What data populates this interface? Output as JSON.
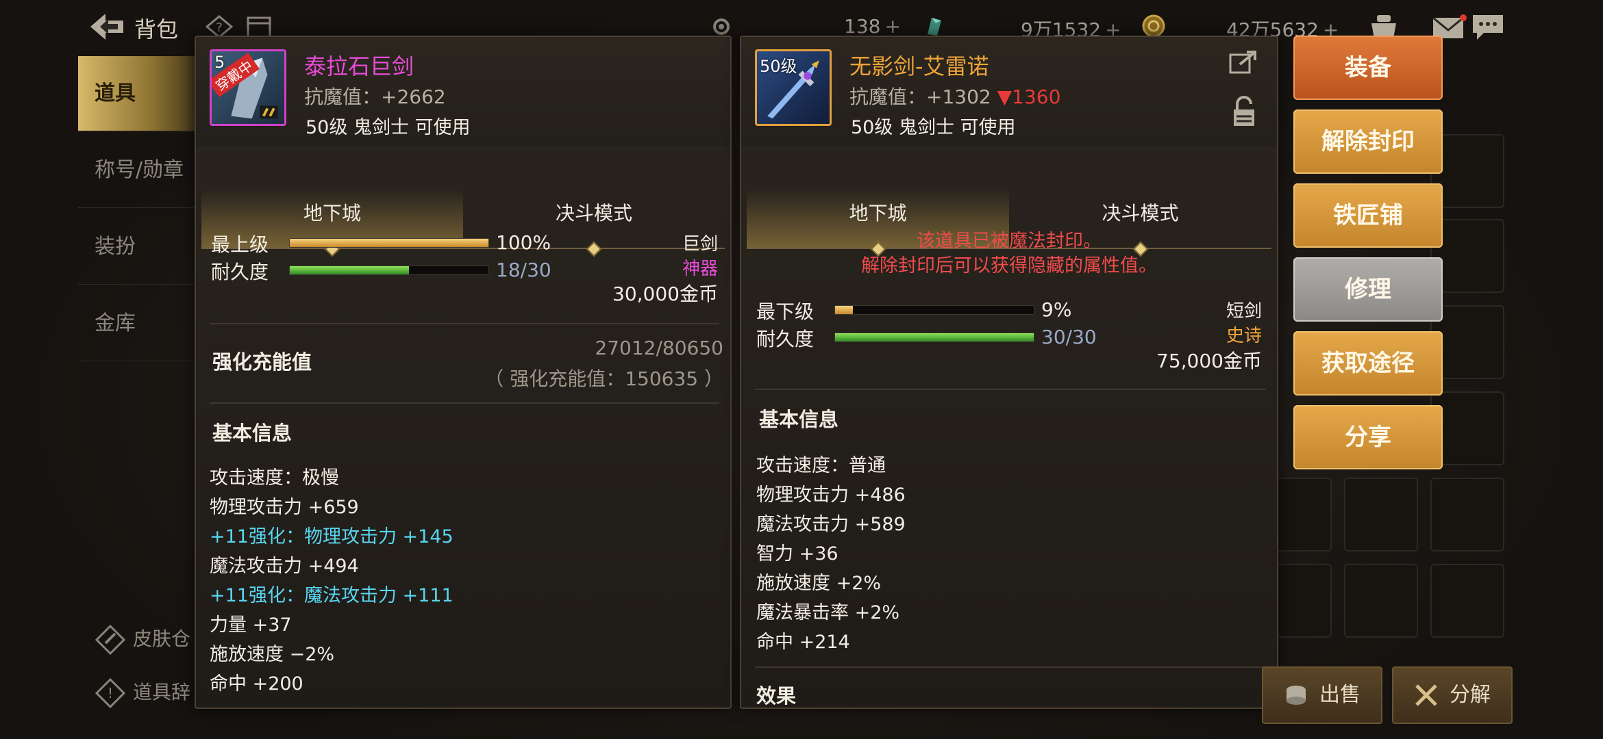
{
  "topbar": {
    "title": "背包",
    "currencies": [
      {
        "amount": "138",
        "plus": "+"
      },
      {
        "amount": "9万1532",
        "plus": "+"
      },
      {
        "amount": "42万5632",
        "plus": "+"
      }
    ]
  },
  "sidebar": {
    "items": [
      {
        "label": "道具",
        "active": true
      },
      {
        "label": "称号/勋章",
        "active": false
      },
      {
        "label": "装扮",
        "active": false
      },
      {
        "label": "金库",
        "active": false
      }
    ],
    "bottom_links": [
      "皮肤仓",
      "道具辞"
    ]
  },
  "left_item": {
    "thumb_level": "5",
    "thumb_tag": "穿戴中",
    "name": "泰拉石巨剑",
    "magic_resist": "抗魔值：+2662",
    "requirement": "50级 鬼剑士 可使用",
    "tabs": [
      "地下城",
      "决斗模式"
    ],
    "grade_label": "最上级",
    "grade_percent": "100%",
    "grade_fraction": 1.0,
    "durability_label": "耐久度",
    "durability": "18/30",
    "durability_fraction": 0.6,
    "weapon_type": "巨剑",
    "rarity": "神器",
    "price": "30,000金币",
    "charge_title": "强化充能值",
    "charge_value": "27012/80650",
    "charge_total": "（ 强化充能值：150635 ）",
    "basic_title": "基本信息",
    "stats": [
      {
        "text": "攻击速度：极慢",
        "color": "white"
      },
      {
        "text": "物理攻击力 +659",
        "color": "white"
      },
      {
        "text": "+11强化：物理攻击力 +145",
        "color": "cyan"
      },
      {
        "text": "魔法攻击力 +494",
        "color": "white"
      },
      {
        "text": "+11强化：魔法攻击力 +111",
        "color": "cyan"
      },
      {
        "text": "力量 +37",
        "color": "white"
      },
      {
        "text": "施放速度 −2%",
        "color": "white"
      },
      {
        "text": "命中 +200",
        "color": "white"
      }
    ]
  },
  "right_item": {
    "thumb_level": "50级",
    "name": "无影剑-艾雷诺",
    "magic_resist": "抗魔值：+1302",
    "magic_resist_diff": "▼1360",
    "requirement": "50级 鬼剑士 可使用",
    "tabs": [
      "地下城",
      "决斗模式"
    ],
    "sealed_line1": "该道具已被魔法封印。",
    "sealed_line2": "解除封印后可以获得隐藏的属性值。",
    "grade_label": "最下级",
    "grade_percent": "9%",
    "grade_fraction": 0.09,
    "durability_label": "耐久度",
    "durability": "30/30",
    "durability_fraction": 1.0,
    "weapon_type": "短剑",
    "rarity": "史诗",
    "price": "75,000金币",
    "basic_title": "基本信息",
    "stats": [
      {
        "text": "攻击速度：普通",
        "color": "white"
      },
      {
        "text": "物理攻击力 +486",
        "color": "white"
      },
      {
        "text": "魔法攻击力 +589",
        "color": "white"
      },
      {
        "text": "智力 +36",
        "color": "white"
      },
      {
        "text": "施放速度 +2%",
        "color": "white"
      },
      {
        "text": "魔法暴击率 +2%",
        "color": "white"
      },
      {
        "text": "命中 +214",
        "color": "white"
      }
    ],
    "effect_title": "效果"
  },
  "actions": [
    "装备",
    "解除封印",
    "铁匠铺",
    "修理",
    "获取途径",
    "分享"
  ],
  "footer": {
    "sell": "出售",
    "disassemble": "分解"
  },
  "colors": {
    "mythic": "#e84cd8",
    "epic": "#f0a53a",
    "enhance": "#58d6f0",
    "sealed": "#ef4c4c",
    "downgrade": "#e83a3a"
  }
}
